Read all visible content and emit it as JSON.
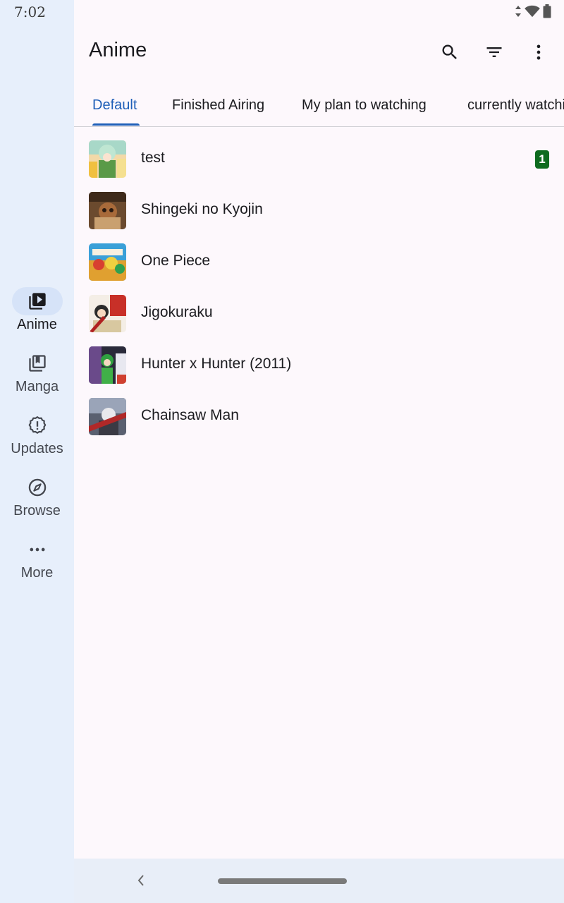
{
  "status_bar": {
    "time": "7:02"
  },
  "nav_rail": {
    "items": [
      {
        "label": "Anime",
        "icon": "play-library-icon",
        "active": true
      },
      {
        "label": "Manga",
        "icon": "book-library-icon",
        "active": false
      },
      {
        "label": "Updates",
        "icon": "alert-badge-icon",
        "active": false
      },
      {
        "label": "Browse",
        "icon": "compass-icon",
        "active": false
      },
      {
        "label": "More",
        "icon": "more-horizontal-icon",
        "active": false
      }
    ]
  },
  "header": {
    "title": "Anime",
    "actions": [
      "search-icon",
      "filter-icon",
      "more-vertical-icon"
    ]
  },
  "tabs": [
    {
      "label": "Default",
      "active": true
    },
    {
      "label": "Finished Airing",
      "active": false
    },
    {
      "label": "My plan to watching",
      "active": false
    },
    {
      "label": "currently watching",
      "active": false
    }
  ],
  "library": [
    {
      "title": "test",
      "badge": "1"
    },
    {
      "title": "Shingeki no Kyojin",
      "badge": ""
    },
    {
      "title": "One Piece",
      "badge": ""
    },
    {
      "title": "Jigokuraku",
      "badge": ""
    },
    {
      "title": "Hunter x Hunter (2011)",
      "badge": ""
    },
    {
      "title": "Chainsaw Man",
      "badge": ""
    }
  ],
  "colors": {
    "accent": "#1f5fb8",
    "rail_background": "#e7effb",
    "badge": "#0e6b1f"
  }
}
